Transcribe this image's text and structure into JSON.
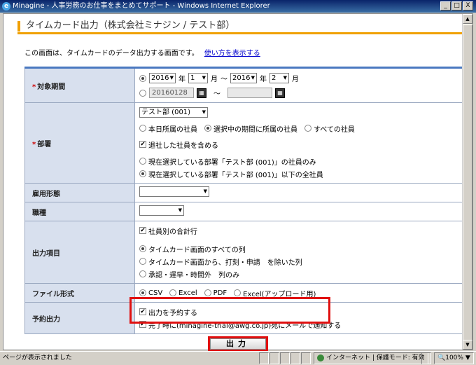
{
  "window": {
    "title": "Minagine - 人事労務のお仕事をまとめてサポート - Windows Internet Explorer",
    "min": "_",
    "max": "□",
    "close": "X"
  },
  "page": {
    "heading": "タイムカード出力（株式会社ミナジン / テスト部）",
    "intro": "この画面は、タイムカードのデータ出力する画面です。",
    "help_link": "使い方を表示する"
  },
  "form": {
    "period": {
      "label": "対象期間",
      "from_year": "2016",
      "from_month": "1",
      "to_year": "2016",
      "to_month": "2",
      "year_unit": "年",
      "month_unit": "月",
      "tilde": "～",
      "date_from": "20160128",
      "date_to": ""
    },
    "department": {
      "label": "部署",
      "selected": "テスト部 (001)",
      "scope_options": [
        "本日所属の社員",
        "選択中の期間に所属の社員",
        "すべての社員"
      ],
      "scope_selected": 1,
      "include_retired": "退社した社員を含める",
      "range_options": [
        "現在選択している部署「テスト部 (001)」の社員のみ",
        "現在選択している部署「テスト部 (001)」以下の全社員"
      ],
      "range_selected": 1
    },
    "employment_type": {
      "label": "雇用形態",
      "value": ""
    },
    "job_type": {
      "label": "職種",
      "value": ""
    },
    "output_items": {
      "label": "出力項目",
      "per_employee_total": "社員別の合計行",
      "options": [
        "タイムカード画面のすべての列",
        "タイムカード画面から、打刻・申請　を除いた列",
        "承認・遅早・時間外　列のみ"
      ],
      "selected": 0
    },
    "file_format": {
      "label": "ファイル形式",
      "options": [
        "CSV",
        "Excel",
        "PDF",
        "Excel(アップロード用)"
      ],
      "selected": 0
    },
    "reservation": {
      "label": "予約出力",
      "reserve": "出力を予約する",
      "notify": "完了時に(minagine-trial@awg.co.jp)宛にメールで通知する"
    },
    "submit": "出力"
  },
  "statusbar": {
    "message": "ページが表示されました",
    "zone": "インターネット | 保護モード: 有効",
    "zoom": "100%"
  },
  "colors": {
    "accent_orange": "#f0a000",
    "label_bg": "#d8e0ee",
    "highlight": "#e01010",
    "required": "#cc0000"
  }
}
